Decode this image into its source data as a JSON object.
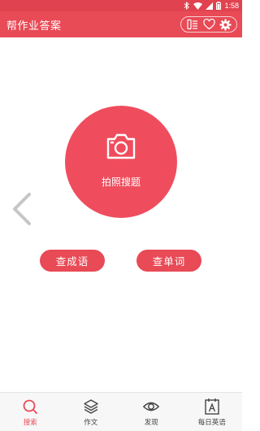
{
  "status_bar": {
    "time": "1:58"
  },
  "app_bar": {
    "title": "帮作业答案"
  },
  "colors": {
    "accent": "#e84a56",
    "status_bar": "#e0434f",
    "circle": "#ef4d5d"
  },
  "main": {
    "camera_label": "拍照搜题",
    "idiom_button": "查成语",
    "word_button": "查单词"
  },
  "bottom_nav": {
    "items": [
      {
        "label": "搜索",
        "icon": "search-icon",
        "active": true
      },
      {
        "label": "作文",
        "icon": "layers-icon",
        "active": false
      },
      {
        "label": "发现",
        "icon": "eye-icon",
        "active": false
      },
      {
        "label": "每日英语",
        "icon": "calendar-a-icon",
        "active": false
      }
    ]
  }
}
